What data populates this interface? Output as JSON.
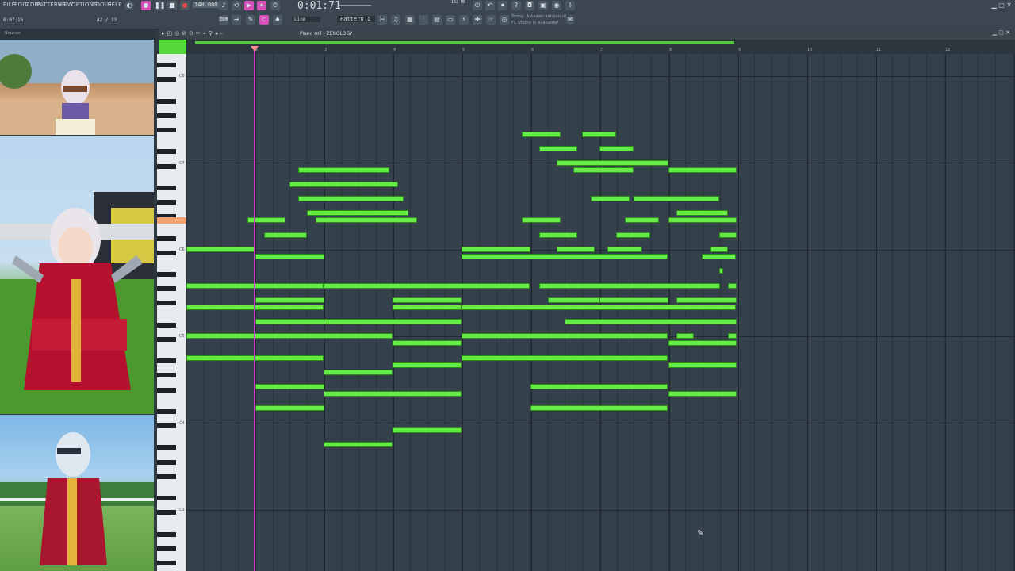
{
  "menu": {
    "file": "FILE",
    "edit": "EDIT",
    "add": "ADD",
    "patterns": "PATTERNS",
    "view": "VIEW",
    "options": "OPTIONS",
    "tools": "TOOLS",
    "help": "HELP"
  },
  "transport": {
    "tempo": "140.000",
    "time": "0:01:71",
    "pattern": "Pattern 1",
    "snap": "Line",
    "cpu_info": "162 MB"
  },
  "hint": {
    "line1": "Today: A newer version of",
    "line2": "FL Studio is available!"
  },
  "hint_left": {
    "time": "0:07:16",
    "voices": "A2 / 33"
  },
  "browser": {
    "label": "Browser"
  },
  "pianoroll": {
    "title": "Piano roll - ZENOLOGY"
  },
  "octaves": [
    "C8",
    "C7",
    "C6",
    "C5",
    "C4",
    "C3"
  ],
  "bars": [
    "2",
    "3",
    "4",
    "5",
    "6",
    "7",
    "8",
    "9",
    "10",
    "11",
    "12"
  ],
  "colors": {
    "note": "#66ec46",
    "playhead": "#c040c0",
    "grid_bg": "#34404a"
  }
}
